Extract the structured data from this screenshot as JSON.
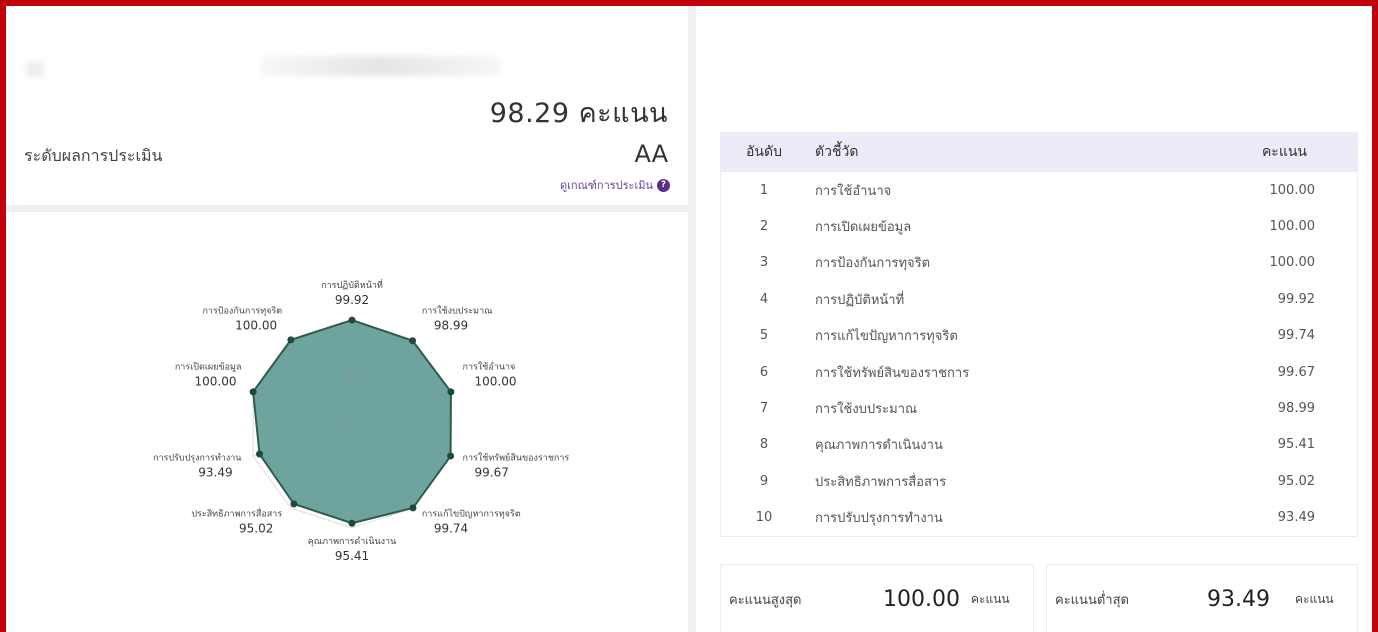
{
  "header": {
    "total_score": "98.29 คะแนน",
    "level_label": "ระดับผลการประเมิน",
    "level_grade": "AA",
    "criteria_link": "ดูเกณฑ์การประเมิน",
    "help_icon": "?"
  },
  "radar": {
    "type": "radar",
    "max": 100,
    "axis_ticks": [
      "0",
      "50"
    ],
    "axes": [
      {
        "label": "การปฏิบัติหน้าที่",
        "value": 99.92,
        "value_text": "99.92"
      },
      {
        "label": "การใช้งบประมาณ",
        "value": 98.99,
        "value_text": "98.99"
      },
      {
        "label": "การใช้อำนาจ",
        "value": 100.0,
        "value_text": "100.00"
      },
      {
        "label": "การใช้ทรัพย์สินของราชการ",
        "value": 99.67,
        "value_text": "99.67"
      },
      {
        "label": "การแก้ไขปัญหาการทุจริต",
        "value": 99.74,
        "value_text": "99.74"
      },
      {
        "label": "คุณภาพการดำเนินงาน",
        "value": 95.41,
        "value_text": "95.41"
      },
      {
        "label": "ประสิทธิภาพการสื่อสาร",
        "value": 95.02,
        "value_text": "95.02"
      },
      {
        "label": "การปรับปรุงการทำงาน",
        "value": 93.49,
        "value_text": "93.49"
      },
      {
        "label": "การเปิดเผยข้อมูล",
        "value": 100.0,
        "value_text": "100.00"
      },
      {
        "label": "การป้องกันการทุจริต",
        "value": 100.0,
        "value_text": "100.00"
      }
    ],
    "fill_color": "#5f9a93",
    "line_color": "#2f5a4e",
    "point_color": "#1e4a3d"
  },
  "table": {
    "headers": {
      "rank": "อันดับ",
      "name": "ตัวชี้วัด",
      "score": "คะแนน"
    },
    "rows": [
      {
        "rank": "1",
        "name": "การใช้อำนาจ",
        "score": "100.00"
      },
      {
        "rank": "2",
        "name": "การเปิดเผยข้อมูล",
        "score": "100.00"
      },
      {
        "rank": "3",
        "name": "การป้องกันการทุจริต",
        "score": "100.00"
      },
      {
        "rank": "4",
        "name": "การปฏิบัติหน้าที่",
        "score": "99.92"
      },
      {
        "rank": "5",
        "name": "การแก้ไขปัญหาการทุจริต",
        "score": "99.74"
      },
      {
        "rank": "6",
        "name": "การใช้ทรัพย์สินของราชการ",
        "score": "99.67"
      },
      {
        "rank": "7",
        "name": "การใช้งบประมาณ",
        "score": "98.99"
      },
      {
        "rank": "8",
        "name": "คุณภาพการดำเนินงาน",
        "score": "95.41"
      },
      {
        "rank": "9",
        "name": "ประสิทธิภาพการสื่อสาร",
        "score": "95.02"
      },
      {
        "rank": "10",
        "name": "การปรับปรุงการทำงาน",
        "score": "93.49"
      }
    ]
  },
  "summary": {
    "max_label": "คะแนนสูงสุด",
    "max_value": "100.00",
    "min_label": "คะแนนต่ำสุด",
    "min_value": "93.49",
    "unit": "คะแนน"
  },
  "colors": {
    "border": "#c0000a",
    "header_bg": "#ecebf7",
    "link": "#6b3fa0"
  }
}
